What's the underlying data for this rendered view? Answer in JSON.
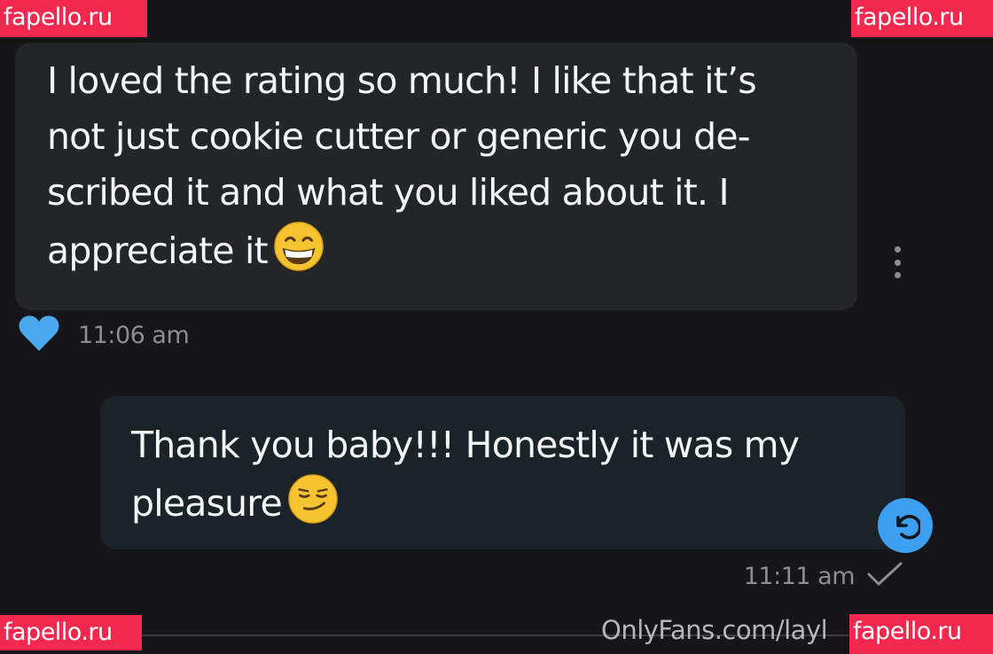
{
  "conversation": {
    "incoming_message": {
      "text": "I loved the rating so much! I like that it’s not just cookie cutter or generic you de-scribed it and what you liked about it. I appreciate it",
      "lines": [
        "I loved the rating so much! I like that it’s",
        "not just cookie cutter or generic you de-",
        "scribed it and what you liked about it. I",
        "appreciate it"
      ],
      "emoji": "grinning-face-with-smiling-eyes",
      "time": "11:06 am",
      "liked": true,
      "like_color": "#4aa8ef"
    },
    "outgoing_message": {
      "text": "Thank you baby!!! Honestly it was my pleasure",
      "lines": [
        "Thank you baby!!! Honestly it was my",
        "pleasure"
      ],
      "emoji": "smirking-face",
      "time": "11:11 am",
      "status": "sent"
    }
  },
  "credit_text": "OnlyFans.com/layl",
  "watermarks": {
    "top_left": "fapello.ru",
    "top_right": "fapello.ru",
    "bottom_left": "fapello.ru",
    "bottom_right": "fapello.ru"
  },
  "colors": {
    "background": "#161618",
    "incoming_bubble": "#232527",
    "outgoing_bubble": "#192328",
    "accent_blue": "#3d9ff0",
    "watermark": "#f2284f"
  }
}
